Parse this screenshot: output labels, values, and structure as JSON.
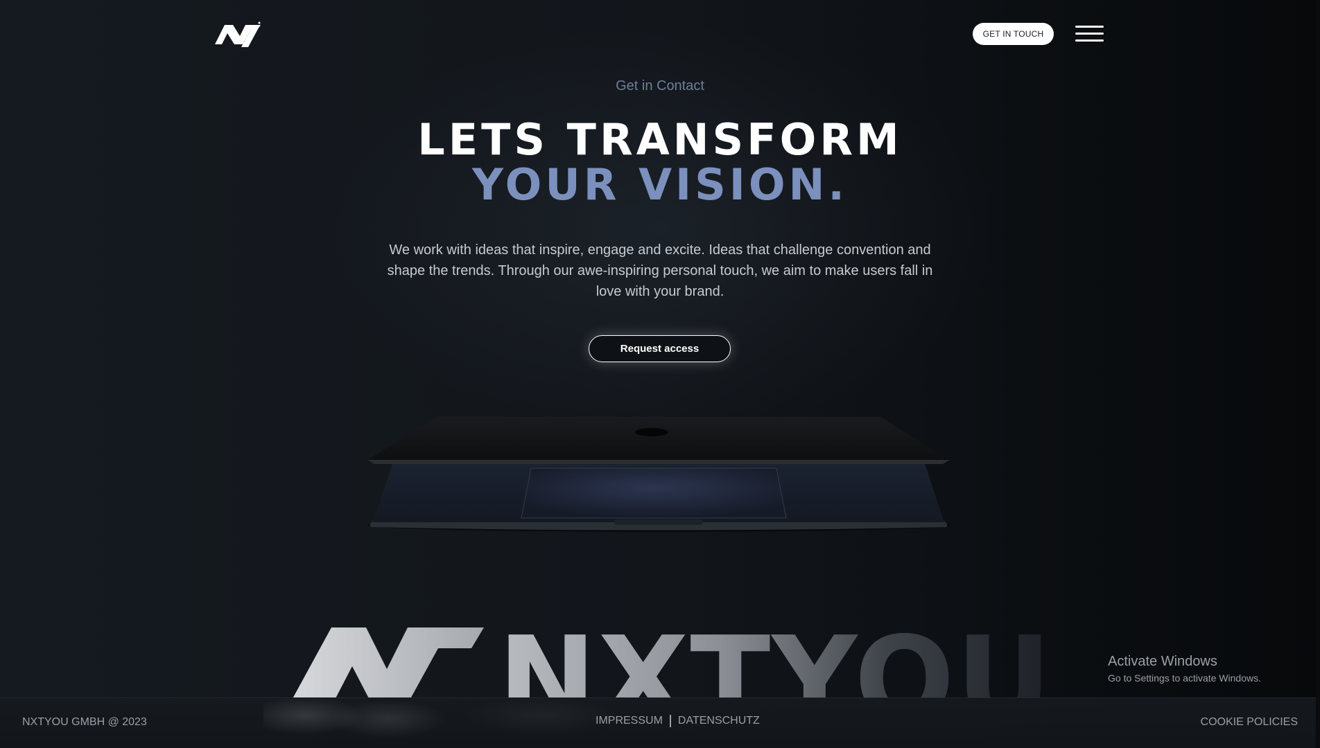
{
  "header": {
    "logo": "NX logo",
    "cta_label": "GET IN TOUCH",
    "menu_icon": "hamburger-menu-icon"
  },
  "hero": {
    "eyebrow": "Get in Contact",
    "title_line1": "LETS TRANSFORM",
    "title_line2": "YOUR VISION.",
    "description": "We work with ideas that inspire, engage and excite. Ideas that challenge convention and shape the trends. Through our awe-inspiring personal touch, we aim to make users fall in love with your brand.",
    "button_label": "Request access",
    "laptop_lid_text": "..."
  },
  "brand": {
    "word": "NXTYOU"
  },
  "watermark": {
    "title": "Activate Windows",
    "subtitle": "Go to Settings to activate Windows."
  },
  "footer": {
    "copyright": "NXTYOU GMBH @ 2023",
    "links": [
      "IMPRESSUM",
      "DATENSCHUTZ"
    ],
    "cookie": "COOKIE POLICIES"
  },
  "colors": {
    "accent": "#7b90bd",
    "eyebrow": "#6e7f98",
    "background": "#12161b",
    "text": "#ffffff"
  }
}
